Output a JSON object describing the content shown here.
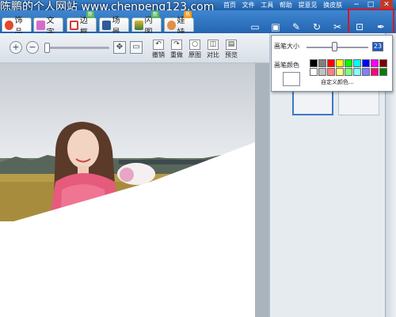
{
  "watermark": "陈鹏的个人网站   www.chenpeng123.com",
  "menu": [
    "首页",
    "文件",
    "工具",
    "帮助",
    "提意见",
    "换皮肤"
  ],
  "window_buttons": [
    "−",
    "□",
    "✕"
  ],
  "tabs": [
    {
      "label": "饰品",
      "icon": "heart-icon",
      "color": "#e34a2f"
    },
    {
      "label": "文字",
      "icon": "text-icon",
      "color": "#d86acb"
    },
    {
      "label": "边框",
      "icon": "frame-icon",
      "color": "#d53a3a",
      "badge": "新"
    },
    {
      "label": "场景",
      "icon": "scene-icon",
      "color": "#2e5c9a"
    },
    {
      "label": "闪图",
      "icon": "flash-icon",
      "color": "#e0b72c",
      "badge": "新"
    },
    {
      "label": "娃娃",
      "icon": "doll-icon",
      "color": "#e08f4a",
      "badge": "热"
    }
  ],
  "right_tools": [
    {
      "label": "打开",
      "icon": "folder-icon"
    },
    {
      "label": "保存",
      "icon": "save-icon"
    },
    {
      "label": "抠图",
      "icon": "cutout-icon"
    },
    {
      "label": "旋转",
      "icon": "rotate-icon"
    },
    {
      "label": "裁剪",
      "icon": "crop-icon"
    },
    {
      "label": "尺寸",
      "icon": "resize-icon"
    },
    {
      "label": "涂鸦",
      "icon": "brush-icon"
    }
  ],
  "edit_tools": [
    "撤销",
    "重做",
    "原图",
    "对比",
    "预览"
  ],
  "popup": {
    "size_label": "画笔大小",
    "size_value": "23",
    "color_label": "画笔颜色",
    "custom_label": "自定义颜色...",
    "palette": [
      "#000000",
      "#808080",
      "#ff0000",
      "#ffff00",
      "#00ff00",
      "#00ffff",
      "#0000ff",
      "#ff00ff",
      "#800000",
      "#ffffff",
      "#c0c0c0",
      "#ff8080",
      "#ffff80",
      "#80ff80",
      "#80ffff",
      "#8080ff",
      "#ff0080",
      "#008000"
    ]
  },
  "colors": {
    "accent": "#2465b0",
    "highlight": "#d9161c"
  }
}
